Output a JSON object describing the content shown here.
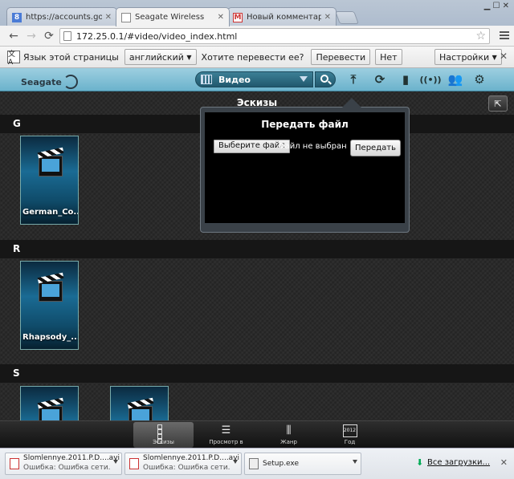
{
  "browser": {
    "tabs": [
      {
        "title": "https://accounts.google.c",
        "icon": "google-icon"
      },
      {
        "title": "Seagate Wireless",
        "icon": "page-icon"
      },
      {
        "title": "Новый комментарий на",
        "icon": "gmail-icon"
      }
    ],
    "url": "172.25.0.1/#video/video_index.html",
    "translate": {
      "prompt": "Язык этой страницы",
      "language": "английский",
      "question": "Хотите перевести ее?",
      "translate_label": "Перевести",
      "no_label": "Нет",
      "settings_label": "Настройки"
    }
  },
  "app": {
    "logo": "Seagate",
    "selector_label": "Видео",
    "view_title": "Эскизы",
    "sections": [
      {
        "letter": "G",
        "items": [
          "German_Co..."
        ]
      },
      {
        "letter": "R",
        "items": [
          "Rhapsody_..."
        ]
      },
      {
        "letter": "S",
        "items": [
          "",
          ""
        ]
      }
    ],
    "upload": {
      "title": "Передать файл",
      "choose_label": "Выберите файл",
      "file_status": "Файл не выбран",
      "send_label": "Передать"
    },
    "bottom_nav": [
      {
        "label": "Эскизы",
        "icon": "grid-icon",
        "active": true
      },
      {
        "label": "Просмотр в",
        "icon": "list-icon",
        "active": false
      },
      {
        "label": "Жанр",
        "icon": "sliders-icon",
        "active": false
      },
      {
        "label": "Год",
        "icon": "calendar-icon",
        "active": false,
        "badge": "2012"
      }
    ]
  },
  "downloads": {
    "items": [
      {
        "name": "Slomlennye.2011.P.D....avi",
        "status": "Ошибка: Ошибка сети."
      },
      {
        "name": "Slomlennye.2011.P.D....avi",
        "status": "Ошибка: Ошибка сети."
      },
      {
        "name": "Setup.exe",
        "status": ""
      }
    ],
    "all_label": "Все загрузки..."
  }
}
